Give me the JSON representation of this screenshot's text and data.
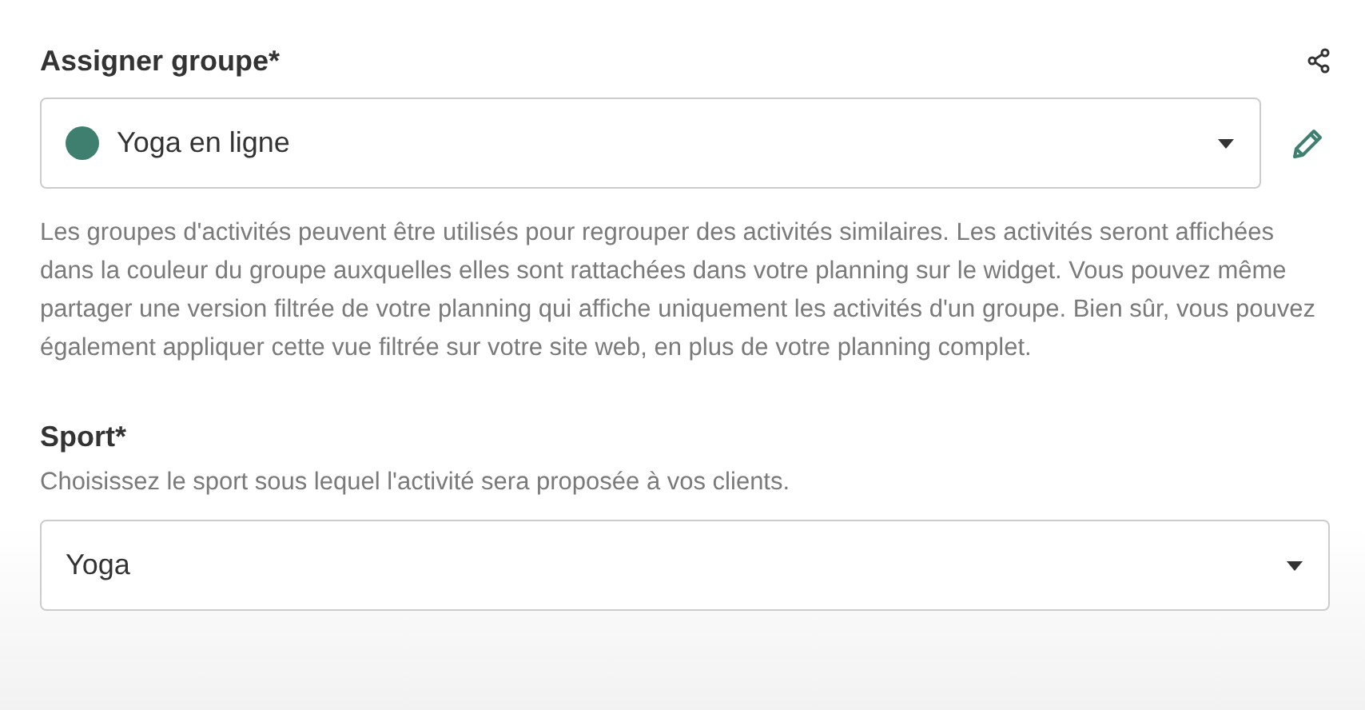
{
  "group_field": {
    "label": "Assigner groupe*",
    "value": "Yoga en ligne",
    "color": "#3e7f6f",
    "description": "Les groupes d'activités peuvent être utilisés pour regrouper des activités similaires. Les activités seront affichées dans la couleur du groupe auxquelles elles sont rattachées dans votre planning sur le widget. Vous pouvez même partager une version filtrée de votre planning qui affiche uniquement les activités d'un groupe. Bien sûr, vous pouvez également appliquer cette vue filtrée sur votre site web, en plus de votre planning complet."
  },
  "sport_field": {
    "label": "Sport*",
    "hint": "Choisissez le sport sous lequel l'activité sera proposée à vos clients.",
    "value": "Yoga"
  }
}
